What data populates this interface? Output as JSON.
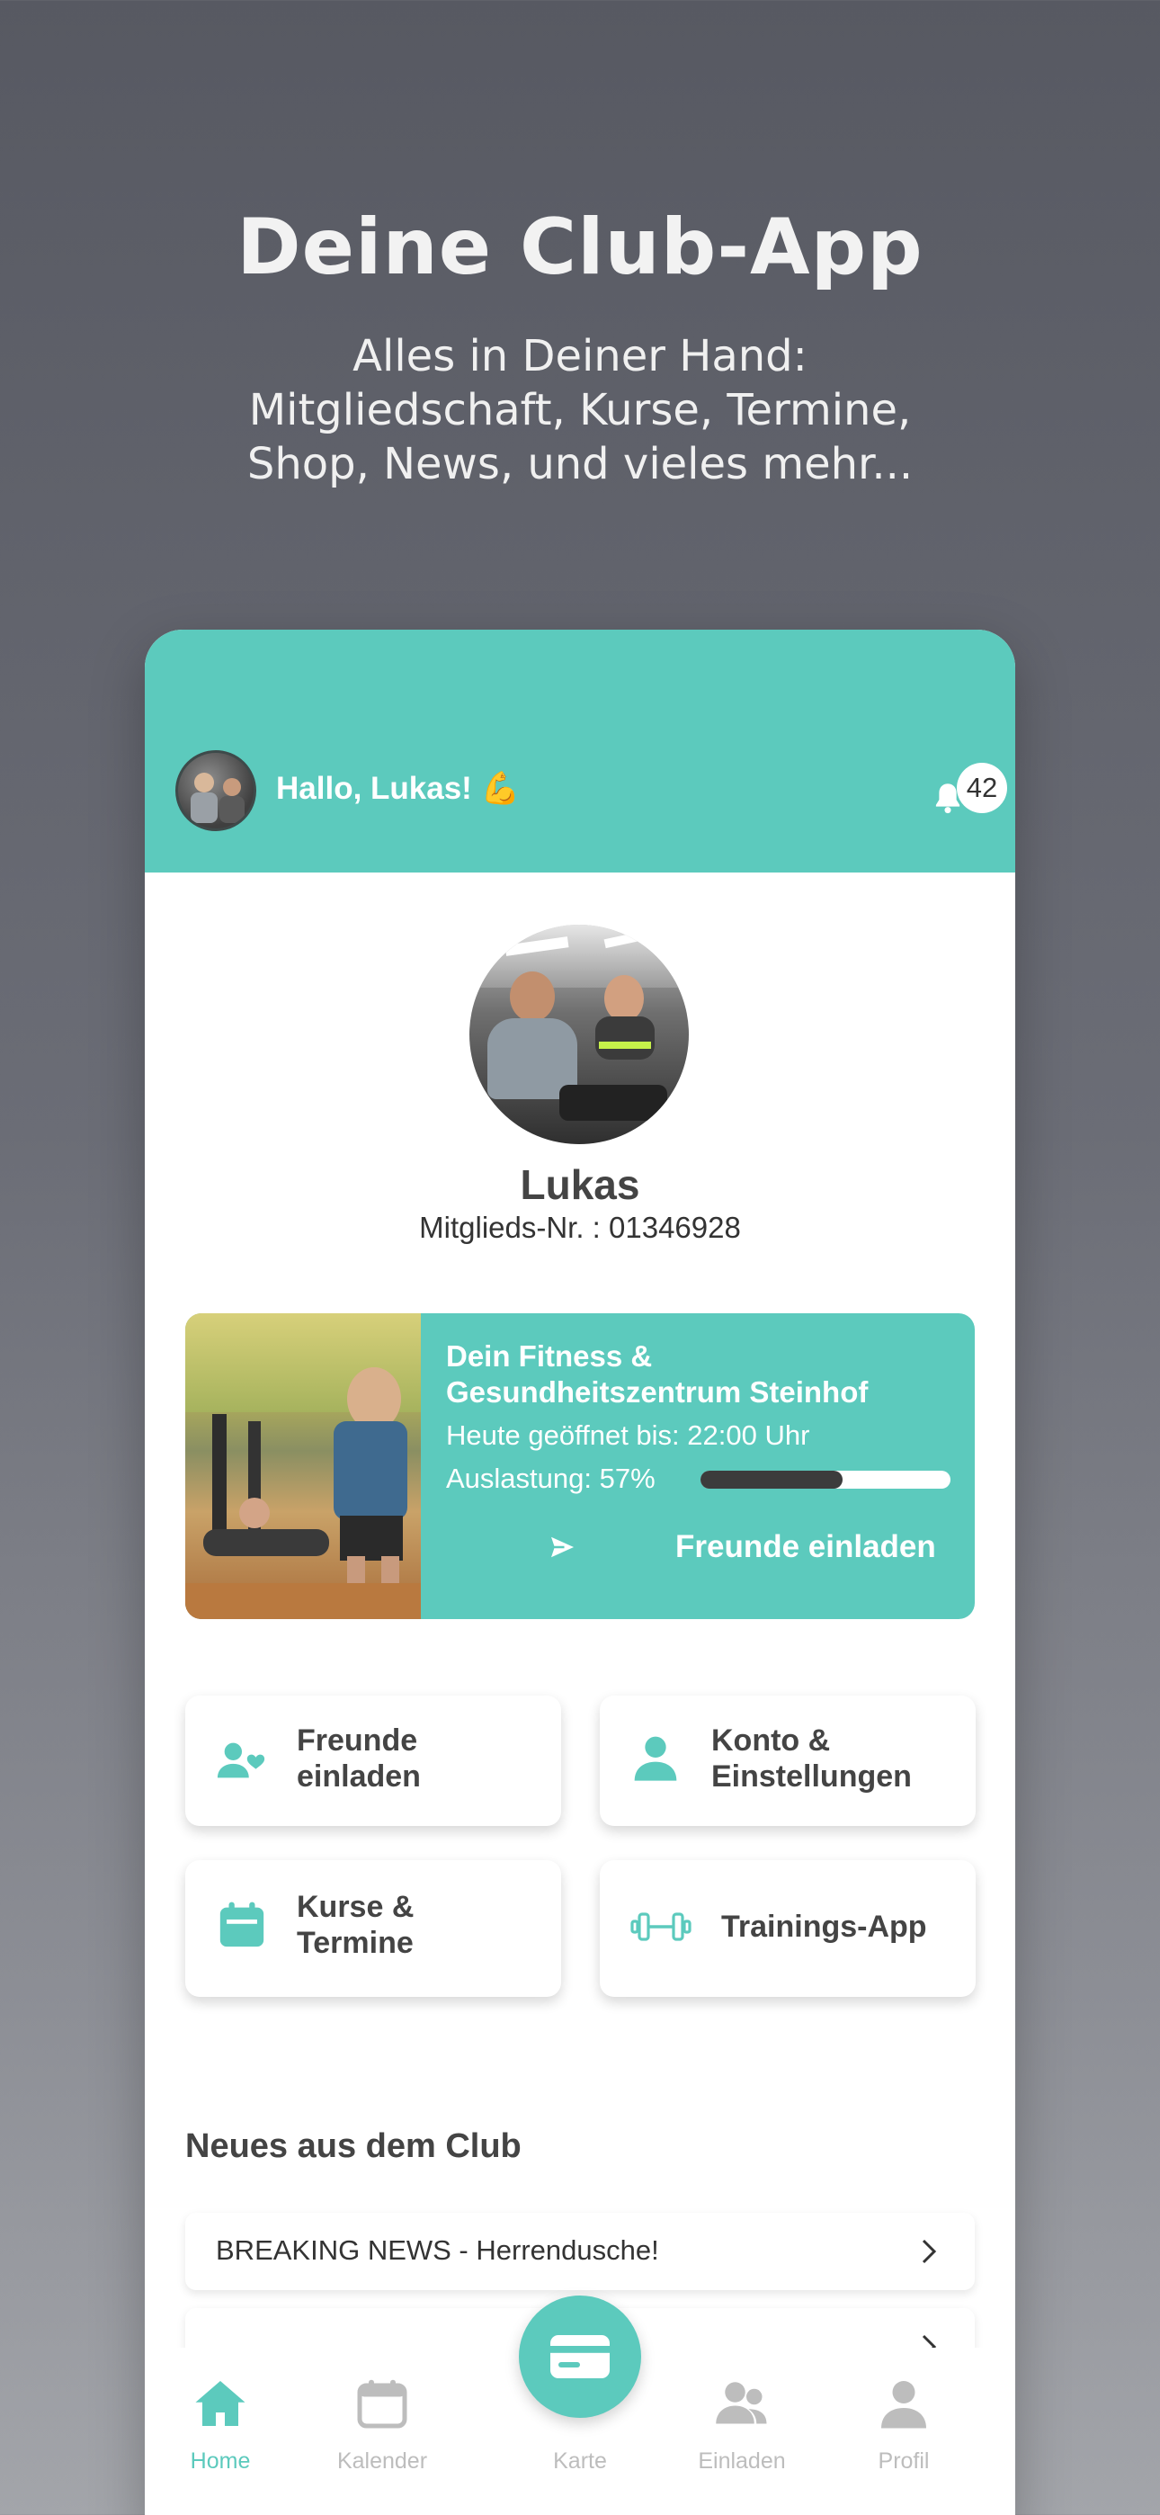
{
  "hero": {
    "title": "Deine Club-App",
    "subtitle_lines": [
      "Alles in Deiner Hand:",
      "Mitgliedschaft, Kurse, Termine,",
      "Shop, News, und vieles mehr..."
    ]
  },
  "header": {
    "greeting": "Hallo, Lukas! 💪",
    "notification_count": "42"
  },
  "profile": {
    "name": "Lukas",
    "member_number": "Mitglieds-Nr. : 01346928"
  },
  "club_card": {
    "name": "Dein Fitness & Gesundheitszentrum Steinhof",
    "opening": "Heute geöffnet bis: 22:00 Uhr",
    "load_label": "Auslastung: 57%",
    "load_percent": 57,
    "invite_label": "Freunde einladen"
  },
  "tiles": [
    {
      "lines": [
        "Freunde",
        "einladen"
      ],
      "icon": "invite-friends-icon"
    },
    {
      "lines": [
        "Konto &",
        "Einstellungen"
      ],
      "icon": "account-icon"
    },
    {
      "lines": [
        "Kurse &",
        "Termine"
      ],
      "icon": "calendar-icon"
    },
    {
      "lines": [
        "Trainings-App"
      ],
      "icon": "dumbbell-icon"
    }
  ],
  "news": {
    "heading": "Neues aus dem Club",
    "items": [
      {
        "title": "BREAKING NEWS - Herrendusche!"
      }
    ]
  },
  "tabbar": {
    "tabs": [
      {
        "label": "Home",
        "icon": "home-icon",
        "active": true
      },
      {
        "label": "Kalender",
        "icon": "calendar-icon",
        "active": false
      },
      {
        "label": "Karte",
        "icon": "card-icon",
        "active": false
      },
      {
        "label": "Einladen",
        "icon": "people-icon",
        "active": false
      },
      {
        "label": "Profil",
        "icon": "person-icon",
        "active": false
      }
    ]
  },
  "colors": {
    "accent": "#5ccabd",
    "text_dark": "#444444",
    "tab_inactive": "#bdbdbd"
  }
}
